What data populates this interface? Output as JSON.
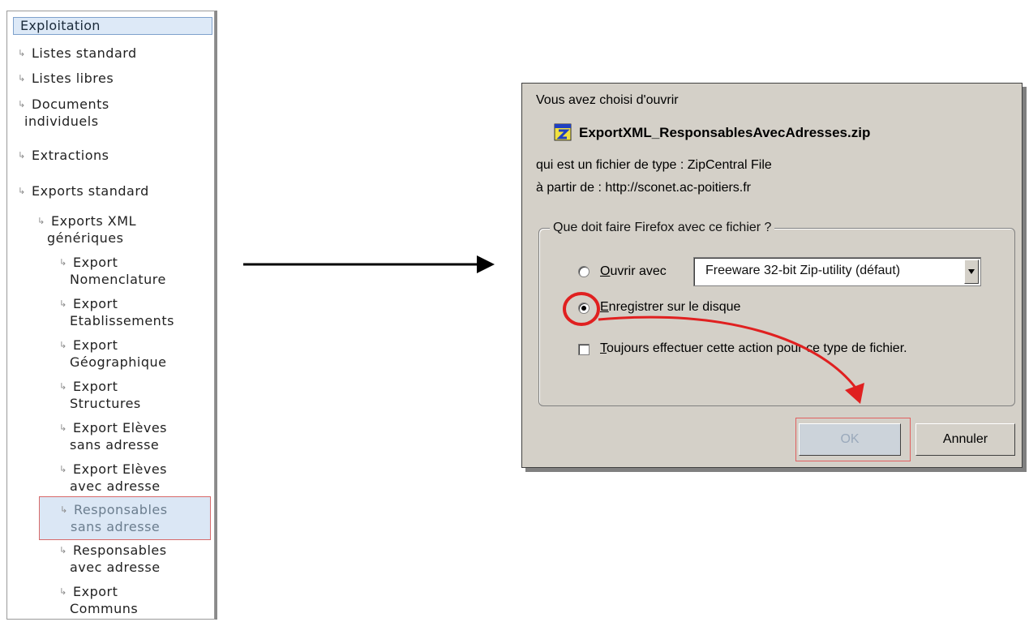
{
  "nav": {
    "header": "Exploitation",
    "items": [
      {
        "line1": "Listes standard",
        "line2": ""
      },
      {
        "line1": "Listes libres",
        "line2": ""
      },
      {
        "line1": "Documents",
        "line2": "individuels"
      },
      {
        "line1": "Extractions",
        "line2": ""
      },
      {
        "line1": "Exports standard",
        "line2": ""
      },
      {
        "line1": "Exports XML",
        "line2": "génériques"
      },
      {
        "line1": "Export",
        "line2": "Nomenclature"
      },
      {
        "line1": "Export",
        "line2": "Etablissements"
      },
      {
        "line1": "Export",
        "line2": "Géographique"
      },
      {
        "line1": "Export",
        "line2": "Structures"
      },
      {
        "line1": "Export Elèves",
        "line2": "sans adresse"
      },
      {
        "line1": "Export Elèves",
        "line2": "avec adresse"
      },
      {
        "line1": "Responsables",
        "line2": "sans adresse"
      },
      {
        "line1": "Responsables",
        "line2": "avec adresse"
      },
      {
        "line1": "Export",
        "line2": "Communs"
      }
    ]
  },
  "dialog": {
    "intro": "Vous avez choisi d'ouvrir",
    "filename": "ExportXML_ResponsablesAvecAdresses.zip",
    "type_line": "qui est un fichier de type :  ZipCentral File",
    "from_line": "à partir de :  http://sconet.ac-poitiers.fr",
    "group_label": "Que doit faire Firefox avec ce fichier ?",
    "open_with_label_u": "O",
    "open_with_label_rest": "uvrir avec",
    "open_with_app": "Freeware 32-bit Zip-utility (défaut)",
    "save_label_u": "E",
    "save_label_rest": "nregistrer sur le disque",
    "always_label_u": "T",
    "always_label_rest": "oujours effectuer cette action pour ce type de fichier.",
    "ok_label": "OK",
    "cancel_label": "Annuler",
    "selected_option": "save"
  },
  "colors": {
    "highlight_red": "#e02020",
    "dialog_bg": "#d4d0c8",
    "nav_selected_bg": "#dbe7f5"
  },
  "icons": [
    "zip-file-icon",
    "tree-arrow-icon",
    "dropdown-arrow-icon",
    "connector-arrow"
  ]
}
